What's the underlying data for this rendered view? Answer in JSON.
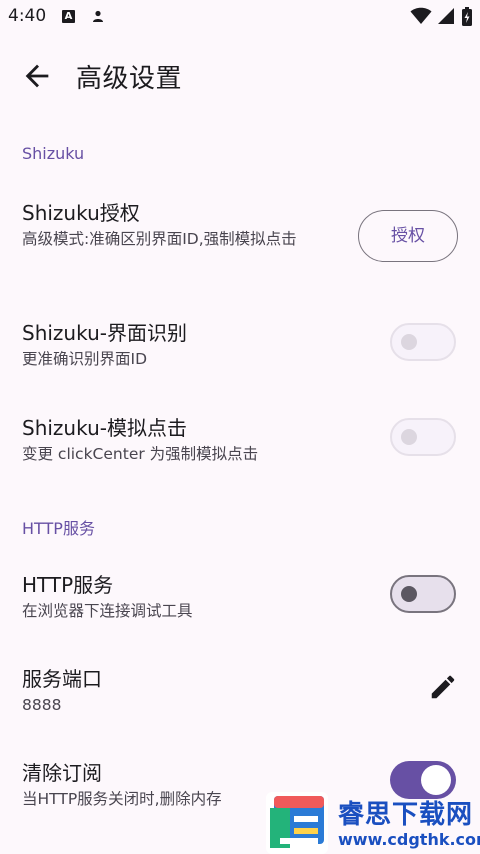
{
  "status_bar": {
    "time": "4:40",
    "a_badge": "A"
  },
  "app_bar": {
    "title": "高级设置"
  },
  "sections": {
    "shizuku": {
      "header": "Shizuku"
    },
    "http": {
      "header": "HTTP服务"
    }
  },
  "items": {
    "shizuku_auth": {
      "title": "Shizuku授权",
      "subtitle": "高级模式:准确区别界面ID,强制模拟点击",
      "button_label": "授权"
    },
    "shizuku_ui": {
      "title": "Shizuku-界面识别",
      "subtitle": "更准确识别界面ID",
      "toggle_on": false
    },
    "shizuku_click": {
      "title": "Shizuku-模拟点击",
      "subtitle": "变更 clickCenter 为强制模拟点击",
      "toggle_on": false
    },
    "http_service": {
      "title": "HTTP服务",
      "subtitle": "在浏览器下连接调试工具",
      "toggle_on": false
    },
    "service_port": {
      "title": "服务端口",
      "value": "8888"
    },
    "clear_sub": {
      "title": "清除订阅",
      "subtitle": "当HTTP服务关闭时,删除内存",
      "toggle_on": true
    }
  },
  "watermark": {
    "line1": "睿思下载网",
    "line2": "www.cdgthk.com"
  },
  "colors": {
    "accent": "#6750a4",
    "background": "#fdf8fc",
    "text": "#1c1b1f",
    "secondary_text": "#49454f"
  }
}
